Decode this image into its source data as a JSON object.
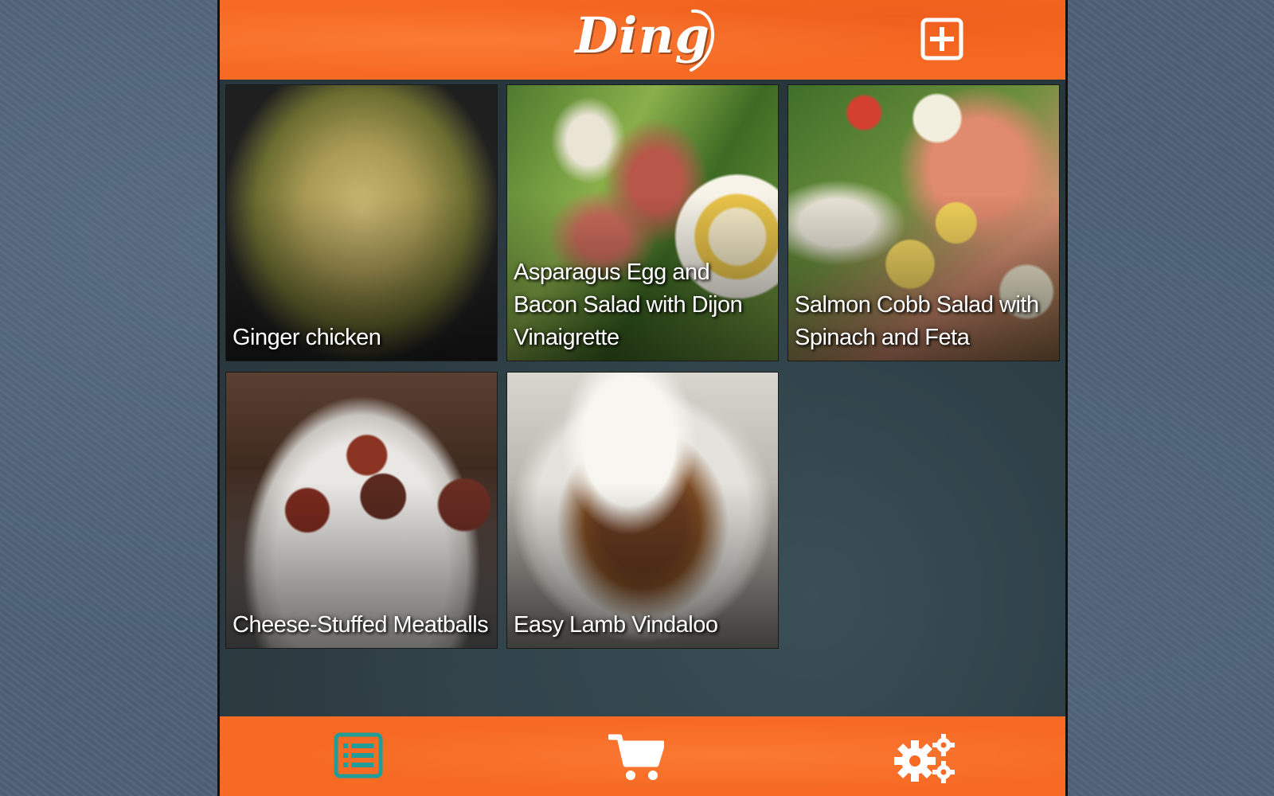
{
  "app": {
    "name": "Ding",
    "accent_color": "#f66a24",
    "list_icon_color": "#1f9d96"
  },
  "header": {
    "logo_text": "Ding",
    "add_button_icon": "plus-square-icon"
  },
  "recipes": [
    {
      "title": "Ginger chicken"
    },
    {
      "title": "Asparagus Egg and Bacon Salad with Dijon Vinaigrette"
    },
    {
      "title": "Salmon Cobb Salad with Spinach and Feta"
    },
    {
      "title": "Cheese-Stuffed Meatballs"
    },
    {
      "title": "Easy Lamb Vindaloo"
    }
  ],
  "bottom_nav": [
    {
      "icon": "list-icon"
    },
    {
      "icon": "cart-icon"
    },
    {
      "icon": "gears-icon"
    }
  ]
}
